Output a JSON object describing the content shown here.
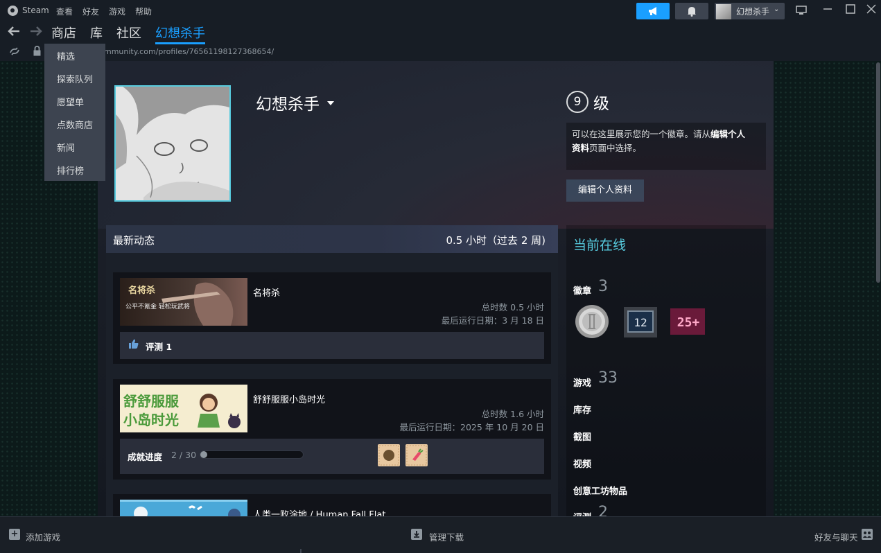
{
  "titlebar": {
    "app_name": "Steam",
    "menus": [
      "查看",
      "好友",
      "游戏",
      "帮助"
    ],
    "username": "幻想杀手",
    "window_controls": [
      "monitor-icon",
      "minimize-icon",
      "maximize-icon",
      "close-icon"
    ]
  },
  "nav": {
    "links": [
      "商店",
      "库",
      "社区",
      "幻想杀手"
    ],
    "active": "幻想杀手",
    "url": "mmunity.com/profiles/76561198127368654/"
  },
  "store_menu": {
    "items": [
      "精选",
      "探索队列",
      "愿望单",
      "点数商店",
      "新闻",
      "排行榜"
    ]
  },
  "profile": {
    "name": "幻想杀手",
    "level": "9",
    "level_label": "级",
    "badge_note_plain_1": "可以在这里展示您的一个徽章。请从",
    "badge_note_bold_1": "编辑个人",
    "badge_note_bold_2": "资料",
    "badge_note_plain_2": "页面中选择。",
    "edit_button": "编辑个人资料"
  },
  "recent": {
    "title": "最新动态",
    "hours": "0.5 小时（过去 2 周)",
    "games": [
      {
        "name": "名将杀",
        "total": "总时数 0.5 小时",
        "last_played": "最后运行日期：3 月 18 日",
        "review_label": "评测 1"
      },
      {
        "name": "舒舒服服小岛时光",
        "total": "总时数 1.6 小时",
        "last_played": "最后运行日期：2025 年 10 月 20 日",
        "ach_label": "成就进度",
        "ach_count": "2 / 30",
        "ach_progress": 0.067,
        "capsule_text_1": "舒舒服服",
        "capsule_text_2": "小岛时光"
      },
      {
        "name": "人类一败涂地 / Human Fall Flat"
      }
    ],
    "game1_capsule_text_1": "名将杀",
    "game1_capsule_text_2": "公平不氪金 轻松玩武将"
  },
  "online": {
    "title": "当前在线",
    "badges_label": "徽章",
    "badges_count": "3",
    "badge_level_text": "12",
    "badge_years_text": "25+",
    "games_label": "游戏",
    "games_count": "33",
    "inventory": "库存",
    "screenshots": "截图",
    "videos": "视频",
    "workshop": "创意工坊物品",
    "reviews_label": "评测",
    "reviews_count": "2"
  },
  "bottombar": {
    "add_game": "添加游戏",
    "downloads": "管理下载",
    "friends_chat": "好友与聊天"
  },
  "colors": {
    "accent": "#1a9fff",
    "online": "#57cbde",
    "background": "#171d25"
  }
}
